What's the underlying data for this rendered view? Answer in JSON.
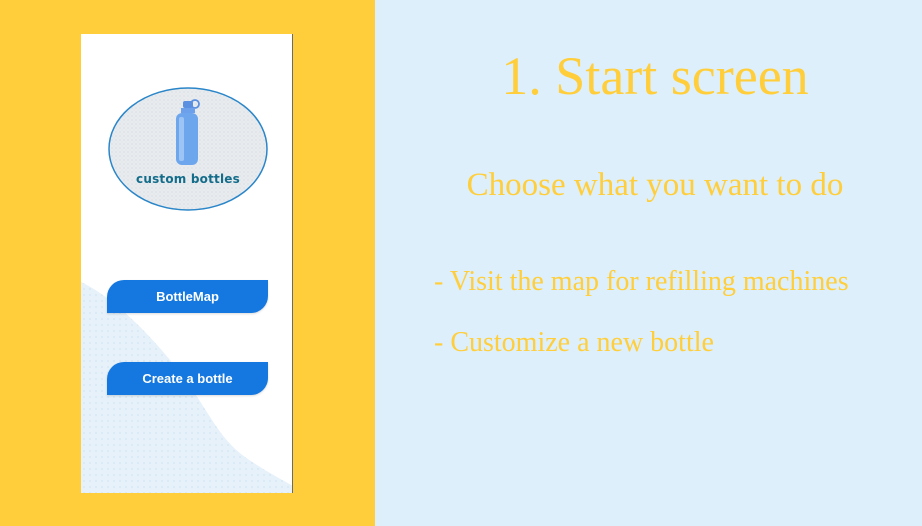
{
  "colors": {
    "left_background": "#FFCE3A",
    "right_background": "#DDEFFB",
    "button_blue": "#1478E0",
    "heading_yellow": "#FFCE3A",
    "logo_text_teal": "#126c8a"
  },
  "app": {
    "logo": {
      "icon": "water-bottle-icon",
      "text": "custom bottles"
    },
    "buttons": {
      "bottle_map": "BottleMap",
      "create_bottle": "Create a bottle"
    }
  },
  "slide": {
    "title": "1. Start screen",
    "subtitle": "Choose what you want to do",
    "bullets": [
      "- Visit the map for refilling machines",
      "- Customize a new bottle"
    ]
  }
}
